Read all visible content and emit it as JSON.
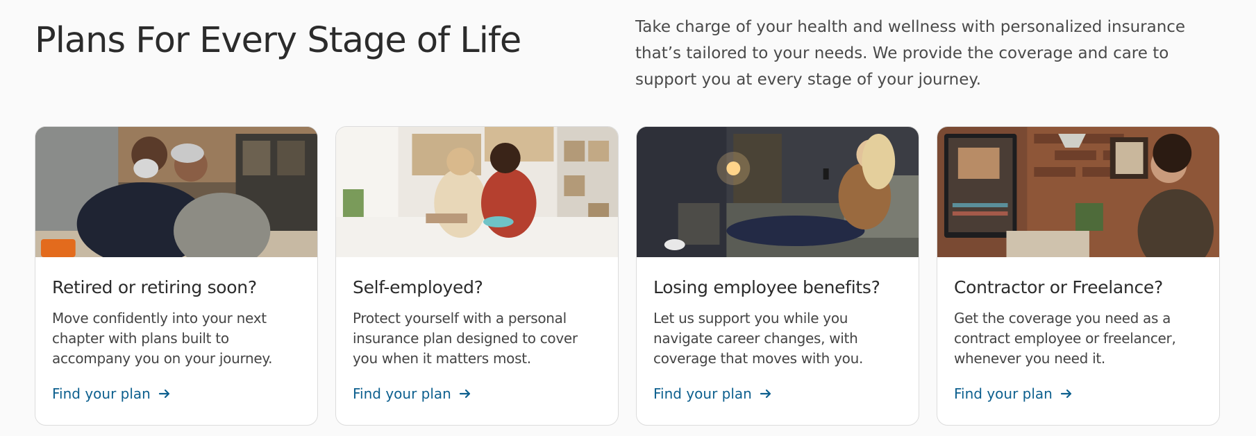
{
  "header": {
    "title": "Plans For Every Stage of Life",
    "intro": "Take charge of your health and wellness with personalized insurance that’s tailored to your needs. We provide the coverage and care to support you at every stage of your journey."
  },
  "cards": [
    {
      "title": "Retired or retiring soon?",
      "description": "Move confidently into your next chapter with plans built to accompany you on your journey.",
      "link_label": "Find your plan",
      "icon": "arrow-right-icon"
    },
    {
      "title": "Self-employed?",
      "description": "Protect yourself with a personal insurance plan designed to cover you when it matters most.",
      "link_label": "Find your plan",
      "icon": "arrow-right-icon"
    },
    {
      "title": "Losing employee benefits?",
      "description": "Let us support you while you navigate career changes, with coverage that moves with you.",
      "link_label": "Find your plan",
      "icon": "arrow-right-icon"
    },
    {
      "title": "Contractor or Freelance?",
      "description": "Get the coverage you need as a contract employee or freelancer, whenever you need it.",
      "link_label": "Find your plan",
      "icon": "arrow-right-icon"
    }
  ],
  "colors": {
    "background": "#fafafa",
    "link": "#0c5f8e",
    "heading": "#2b2b2b",
    "card_border": "#dcdcdc"
  }
}
